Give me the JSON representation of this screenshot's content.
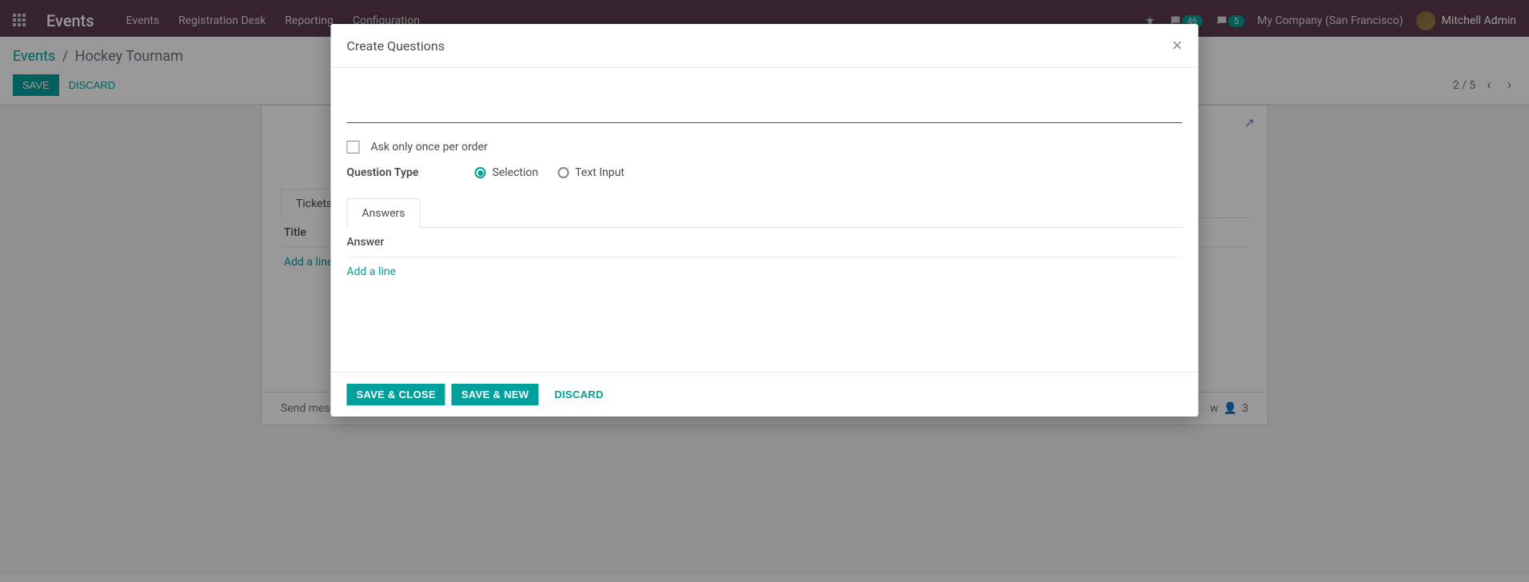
{
  "navbar": {
    "brand": "Events",
    "links": [
      "Events",
      "Registration Desk",
      "Reporting",
      "Configuration"
    ],
    "badge1": "46",
    "badge2": "5",
    "company": "My Company (San Francisco)",
    "user": "Mitchell Admin"
  },
  "breadcrumb": {
    "root": "Events",
    "current": "Hockey Tournam"
  },
  "control": {
    "save": "SAVE",
    "discard": "DISCARD",
    "pager": "2 / 5"
  },
  "sheet": {
    "tab_tickets": "Tickets",
    "col_title": "Title",
    "add_line": "Add a line"
  },
  "chatter": {
    "send_message": "Send messa",
    "follow_count": "3",
    "following_suffix": "w"
  },
  "modal": {
    "title": "Create Questions",
    "ask_once": "Ask only once per order",
    "qtype_label": "Question Type",
    "opt_selection": "Selection",
    "opt_text": "Text Input",
    "tab_answers": "Answers",
    "col_answer": "Answer",
    "add_line": "Add a line",
    "save_close": "SAVE & CLOSE",
    "save_new": "SAVE & NEW",
    "discard": "DISCARD"
  }
}
